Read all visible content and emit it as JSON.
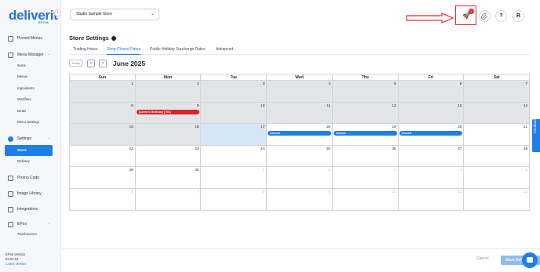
{
  "brand": {
    "name": "deliverit",
    "sub": "EPOS"
  },
  "sidebar": {
    "collapse_icon": "›",
    "items": [
      {
        "label": "Pinned Menus",
        "icon": "pin-icon"
      },
      {
        "label": "Menu Manager",
        "icon": "menu-icon",
        "sub": [
          "Items",
          "Menus",
          "Ingredients",
          "Modifiers",
          "Deals",
          "Menu Settings"
        ]
      },
      {
        "label": "Settings",
        "icon": "gear-icon",
        "sub": [
          "Store",
          "Delivery"
        ]
      },
      {
        "label": "Promo Code",
        "icon": "tag-icon"
      },
      {
        "label": "Image Library",
        "icon": "image-icon"
      },
      {
        "label": "Integrations",
        "icon": "plug-icon"
      },
      {
        "label": "EPos",
        "icon": "pos-icon",
        "sub": [
          "Touchscreen"
        ]
      }
    ],
    "caret": "⌃",
    "version": {
      "label": "EPos Version",
      "number": "02.20.63",
      "link": "Latest Version"
    }
  },
  "header": {
    "store_select": "Studio Sample Store",
    "chev": "⌄",
    "notification_count": "1",
    "help": "?",
    "user_initial": "R"
  },
  "page": {
    "title": "Store Settings",
    "tabs": [
      "Trading Hours",
      "Shop Closed Dates",
      "Public Holiday Surcharge Dates",
      "Advanced"
    ],
    "active_tab": "Shop Closed Dates"
  },
  "calendar": {
    "today_label": "Today",
    "prev": "‹",
    "next": "›",
    "month": "June 2025",
    "weekdays": [
      "Sun",
      "Mon",
      "Tue",
      "Wed",
      "Thu",
      "Fri",
      "Sat"
    ],
    "weeks": [
      [
        "1",
        "2",
        "3",
        "4",
        "5",
        "6",
        "7"
      ],
      [
        "8",
        "9",
        "10",
        "11",
        "12",
        "13",
        "14"
      ],
      [
        "15",
        "16",
        "17",
        "18",
        "19",
        "20",
        "21"
      ],
      [
        "22",
        "23",
        "24",
        "25",
        "26",
        "27",
        "28"
      ],
      [
        "29",
        "30",
        "1",
        "2",
        "3",
        "4",
        "5"
      ],
      [
        "6",
        "7",
        "8",
        "9",
        "10",
        "11",
        "12"
      ]
    ],
    "events": {
      "holiday": "Queen's Birthday (VIC)",
      "closed": "Closed"
    }
  },
  "footer": {
    "cancel": "Cancel",
    "save": "Save Settings"
  },
  "feedback": "Feedback",
  "colors": {
    "primary": "#1f7ee8",
    "danger": "#d8232a",
    "past": "#e2e4e7",
    "today": "#d6e6f8"
  }
}
